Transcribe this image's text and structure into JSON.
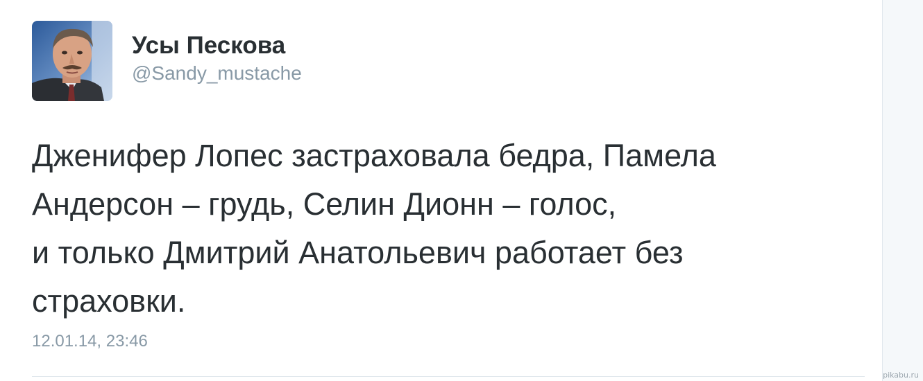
{
  "tweet": {
    "display_name": "Усы Пескова",
    "username": "@Sandy_mustache",
    "text_lines": [
      "Дженифер Лопес застраховала бедра, Памела",
      "Андерсон – грудь, Селин Дионн – голос,",
      "и только Дмитрий Анатольевич работает без",
      "страховки."
    ],
    "timestamp": "12.01.14, 23:46"
  },
  "watermark": "pikabu.ru",
  "icons": {
    "avatar": "profile-photo"
  },
  "colors": {
    "text": "#292f33",
    "muted": "#8899a6",
    "background": "#f5f8fa"
  }
}
